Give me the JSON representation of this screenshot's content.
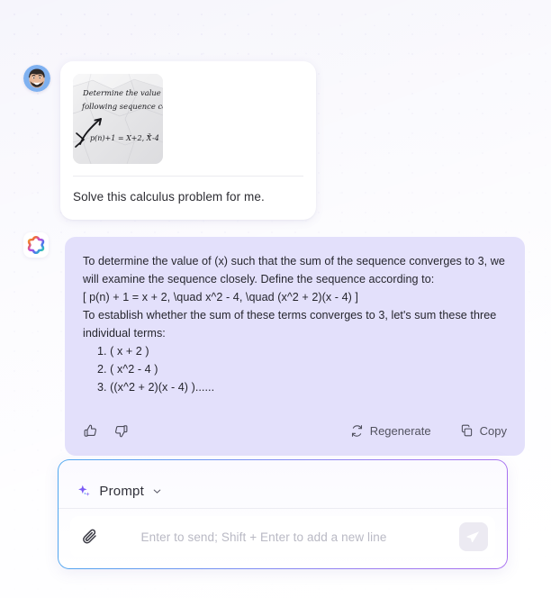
{
  "theme": {
    "background": "#f6f5fc",
    "assistant_bubble": "#e3e0fb",
    "user_card": "#ffffff",
    "accent_gradient_start": "#4fa8ef",
    "accent_gradient_end": "#a86ff0",
    "sparkle_purple": "#7c5cf5",
    "text_primary": "#26262e",
    "text_muted": "#b9b9c4"
  },
  "user_message": {
    "avatar_icon": "user-memoji-avatar",
    "attachment": {
      "icon": "handwritten-note-thumbnail",
      "line1": "Determine the value of",
      "line2": "following sequence cove",
      "line3": "p(n)+1 = X+2,  X² -4"
    },
    "text": "Solve this calculus problem for me."
  },
  "assistant_message": {
    "logo_icon": "ai-clover-logo",
    "paragraphs": [
      "To determine the value of (x) such that the sum of the sequence converges to 3, we will examine the sequence closely. Define the sequence according to:",
      "[ p(n) + 1 = x + 2, \\quad x^2 - 4, \\quad (x^2 + 2)(x - 4) ]",
      "To establish whether the sum of these terms converges to 3, let's sum these three individual terms:"
    ],
    "list_items": [
      "1. ( x + 2 )",
      "2. ( x^2 - 4 )",
      "3. ((x^2 + 2)(x - 4) )......"
    ],
    "actions": {
      "thumbs_up_icon": "thumbs-up-icon",
      "thumbs_down_icon": "thumbs-down-icon",
      "regenerate_label": "Regenerate",
      "regenerate_icon": "refresh-icon",
      "copy_label": "Copy",
      "copy_icon": "copy-icon"
    }
  },
  "composer": {
    "mode_label": "Prompt",
    "mode_icon": "sparkle-icon",
    "chevron_icon": "chevron-down-icon",
    "attach_icon": "paperclip-icon",
    "placeholder": "Enter to send; Shift + Enter to add a new line",
    "input_value": "",
    "send_icon": "send-paper-plane-icon"
  }
}
